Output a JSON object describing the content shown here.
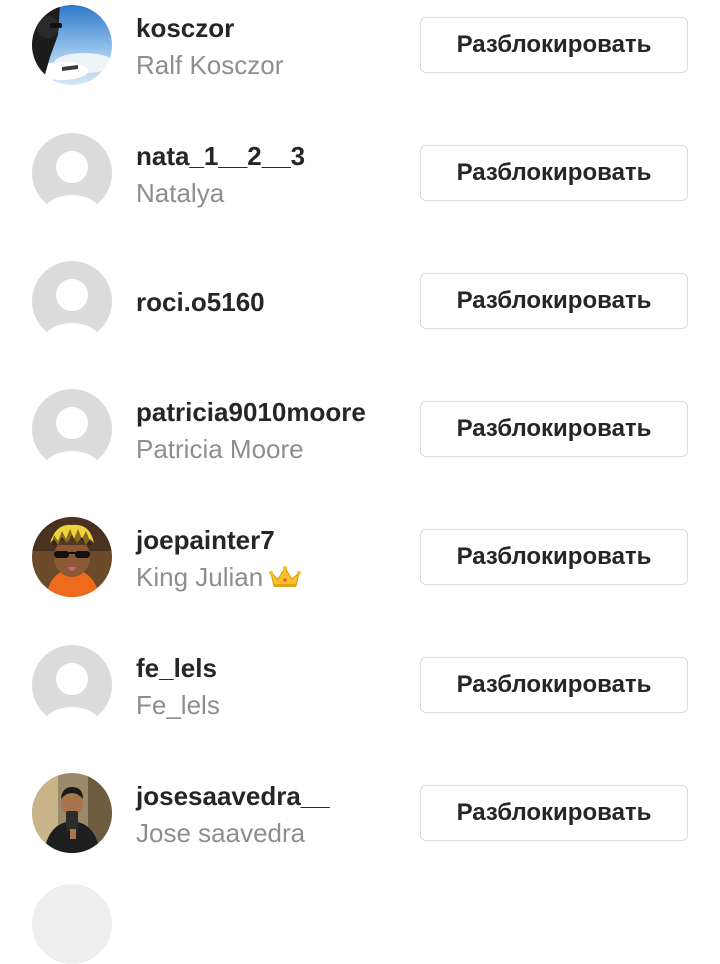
{
  "blocked_accounts": [
    {
      "username": "kosczor",
      "full_name": "Ralf Kosczor",
      "avatar": "photo-sky-airplane",
      "action_label": "Разблокировать"
    },
    {
      "username": "nata_1__2__3",
      "full_name": "Natalya",
      "avatar": "default-avatar",
      "action_label": "Разблокировать"
    },
    {
      "username": "roci.o5160",
      "full_name": "",
      "avatar": "default-avatar",
      "action_label": "Разблокировать"
    },
    {
      "username": "patricia9010moore",
      "full_name": "Patricia Moore",
      "avatar": "default-avatar",
      "action_label": "Разблокировать"
    },
    {
      "username": "joepainter7",
      "full_name": "King Julian",
      "name_emoji": "crown-icon",
      "avatar": "photo-person-sunglasses",
      "action_label": "Разблокировать"
    },
    {
      "username": "fe_lels",
      "full_name": "Fe_lels",
      "avatar": "default-avatar",
      "action_label": "Разблокировать"
    },
    {
      "username": "josesaavedra__",
      "full_name": "Jose saavedra",
      "avatar": "photo-person-mirror-selfie",
      "action_label": "Разблокировать"
    }
  ],
  "colors": {
    "username": "#262626",
    "full_name": "#8e8e8e",
    "button_border": "#dbdbdb",
    "default_avatar_bg": "#dbdbdb",
    "default_avatar_fg": "#ffffff"
  }
}
